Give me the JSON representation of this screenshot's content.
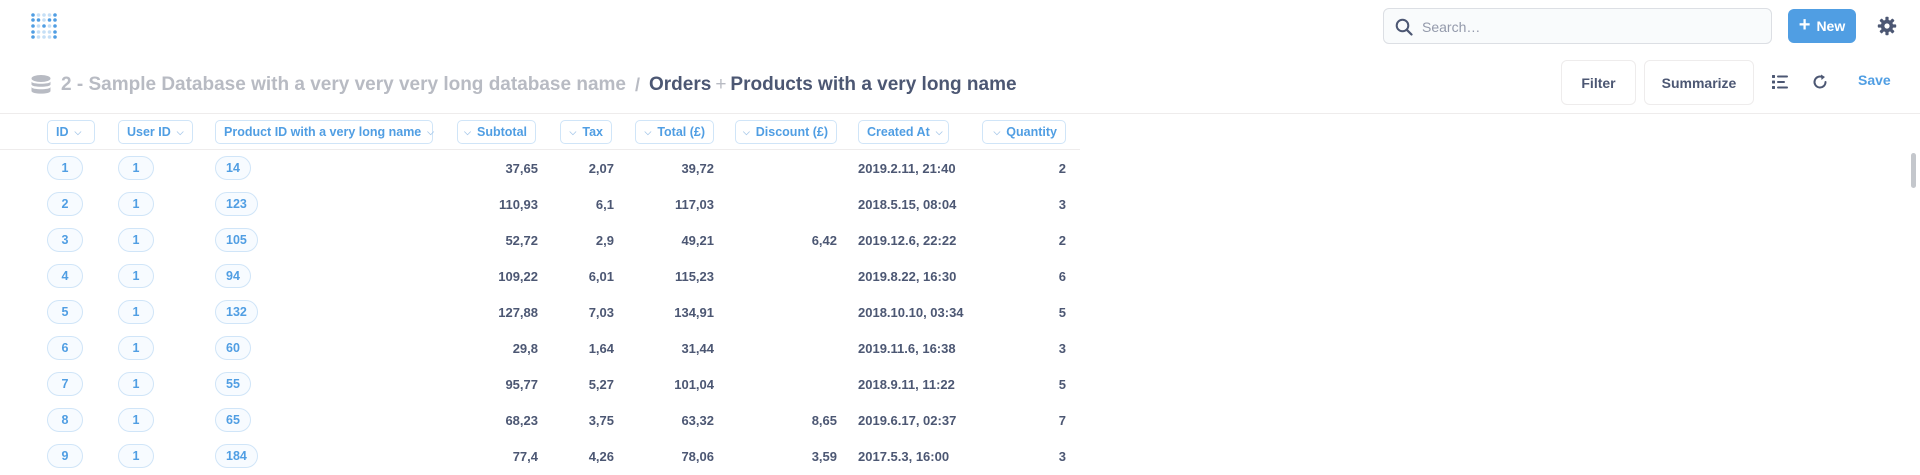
{
  "nav": {
    "search_placeholder": "Search…",
    "new_label": "New",
    "brand_color": "#509ee3"
  },
  "header": {
    "database": "2 - Sample Database with a very very very long database name",
    "separator": "/",
    "table": "Orders",
    "join_symbol": "+",
    "joined_table": "Products with a very long name",
    "filter_label": "Filter",
    "summarize_label": "Summarize",
    "save_label": "Save"
  },
  "table": {
    "columns": [
      "ID",
      "User ID",
      "Product ID with a very long name",
      "Subtotal",
      "Tax",
      "Total (£)",
      "Discount (£)",
      "Created At",
      "Quantity"
    ],
    "rows": [
      [
        "1",
        "1",
        "14",
        "37,65",
        "2,07",
        "39,72",
        "",
        "2019.2.11, 21:40",
        "2"
      ],
      [
        "2",
        "1",
        "123",
        "110,93",
        "6,1",
        "117,03",
        "",
        "2018.5.15, 08:04",
        "3"
      ],
      [
        "3",
        "1",
        "105",
        "52,72",
        "2,9",
        "49,21",
        "6,42",
        "2019.12.6, 22:22",
        "2"
      ],
      [
        "4",
        "1",
        "94",
        "109,22",
        "6,01",
        "115,23",
        "",
        "2019.8.22, 16:30",
        "6"
      ],
      [
        "5",
        "1",
        "132",
        "127,88",
        "7,03",
        "134,91",
        "",
        "2018.10.10, 03:34",
        "5"
      ],
      [
        "6",
        "1",
        "60",
        "29,8",
        "1,64",
        "31,44",
        "",
        "2019.11.6, 16:38",
        "3"
      ],
      [
        "7",
        "1",
        "55",
        "95,77",
        "5,27",
        "101,04",
        "",
        "2018.9.11, 11:22",
        "5"
      ],
      [
        "8",
        "1",
        "65",
        "68,23",
        "3,75",
        "63,32",
        "8,65",
        "2019.6.17, 02:37",
        "7"
      ],
      [
        "9",
        "1",
        "184",
        "77,4",
        "4,26",
        "78,06",
        "3,59",
        "2017.5.3, 16:00",
        "3"
      ]
    ]
  }
}
